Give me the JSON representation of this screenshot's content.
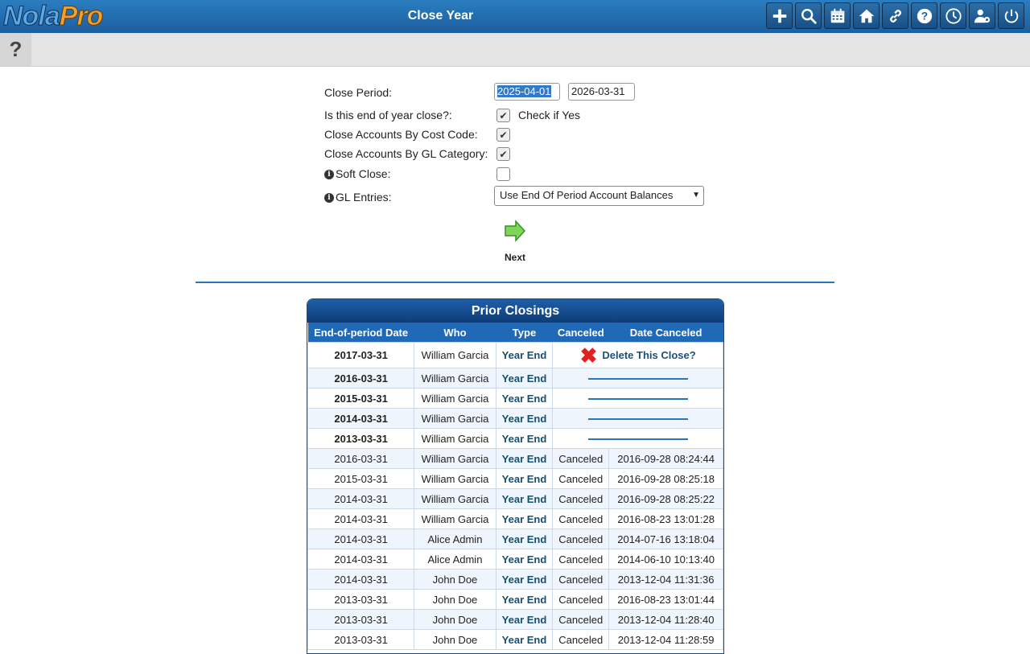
{
  "header": {
    "logo_part1": "Nola",
    "logo_part2": "Pro",
    "title": "Close Year",
    "icons": [
      "plus-icon",
      "search-icon",
      "calendar-icon",
      "home-icon",
      "link-icon",
      "help-icon",
      "clock-icon",
      "user-settings-icon",
      "power-icon"
    ]
  },
  "subbar": {
    "help_label": "?"
  },
  "form": {
    "close_period_label": "Close Period:",
    "start_date": "2025-04-01",
    "end_date": "2026-03-31",
    "end_of_year_label": "Is this end of year close?:",
    "end_of_year_checked": true,
    "end_of_year_hint": "Check if Yes",
    "cost_code_label": "Close Accounts By Cost Code:",
    "cost_code_checked": true,
    "gl_category_label": "Close Accounts By GL Category:",
    "gl_category_checked": true,
    "soft_close_label": "Soft Close:",
    "soft_close_checked": false,
    "gl_entries_label": "GL Entries:",
    "gl_entries_value": "Use End Of Period Account Balances",
    "next_label": "Next"
  },
  "prior_closings": {
    "title": "Prior Closings",
    "columns": [
      "End-of-period Date",
      "Who",
      "Type",
      "Canceled",
      "Date Canceled"
    ],
    "delete_label": "Delete This Close?",
    "rows": [
      {
        "date": "2017-03-31",
        "who": "William Garcia",
        "type": "Year End",
        "canceled": "",
        "date_canceled": "",
        "active": true,
        "delete": true
      },
      {
        "date": "2016-03-31",
        "who": "William Garcia",
        "type": "Year End",
        "canceled": "",
        "date_canceled": "",
        "active": true
      },
      {
        "date": "2015-03-31",
        "who": "William Garcia",
        "type": "Year End",
        "canceled": "",
        "date_canceled": "",
        "active": true
      },
      {
        "date": "2014-03-31",
        "who": "William Garcia",
        "type": "Year End",
        "canceled": "",
        "date_canceled": "",
        "active": true
      },
      {
        "date": "2013-03-31",
        "who": "William Garcia",
        "type": "Year End",
        "canceled": "",
        "date_canceled": "",
        "active": true
      },
      {
        "date": "2016-03-31",
        "who": "William Garcia",
        "type": "Year End",
        "canceled": "Canceled",
        "date_canceled": "2016-09-28 08:24:44"
      },
      {
        "date": "2015-03-31",
        "who": "William Garcia",
        "type": "Year End",
        "canceled": "Canceled",
        "date_canceled": "2016-09-28 08:25:18"
      },
      {
        "date": "2014-03-31",
        "who": "William Garcia",
        "type": "Year End",
        "canceled": "Canceled",
        "date_canceled": "2016-09-28 08:25:22"
      },
      {
        "date": "2014-03-31",
        "who": "William Garcia",
        "type": "Year End",
        "canceled": "Canceled",
        "date_canceled": "2016-08-23 13:01:28"
      },
      {
        "date": "2014-03-31",
        "who": "Alice Admin",
        "type": "Year End",
        "canceled": "Canceled",
        "date_canceled": "2014-07-16 13:18:04"
      },
      {
        "date": "2014-03-31",
        "who": "Alice Admin",
        "type": "Year End",
        "canceled": "Canceled",
        "date_canceled": "2014-06-10 10:13:40"
      },
      {
        "date": "2014-03-31",
        "who": "John Doe",
        "type": "Year End",
        "canceled": "Canceled",
        "date_canceled": "2013-12-04 11:31:36"
      },
      {
        "date": "2013-03-31",
        "who": "John Doe",
        "type": "Year End",
        "canceled": "Canceled",
        "date_canceled": "2016-08-23 13:01:44"
      },
      {
        "date": "2013-03-31",
        "who": "John Doe",
        "type": "Year End",
        "canceled": "Canceled",
        "date_canceled": "2013-12-04 11:28:40"
      },
      {
        "date": "2013-03-31",
        "who": "John Doe",
        "type": "Year End",
        "canceled": "Canceled",
        "date_canceled": "2013-12-04 11:28:59"
      }
    ]
  }
}
